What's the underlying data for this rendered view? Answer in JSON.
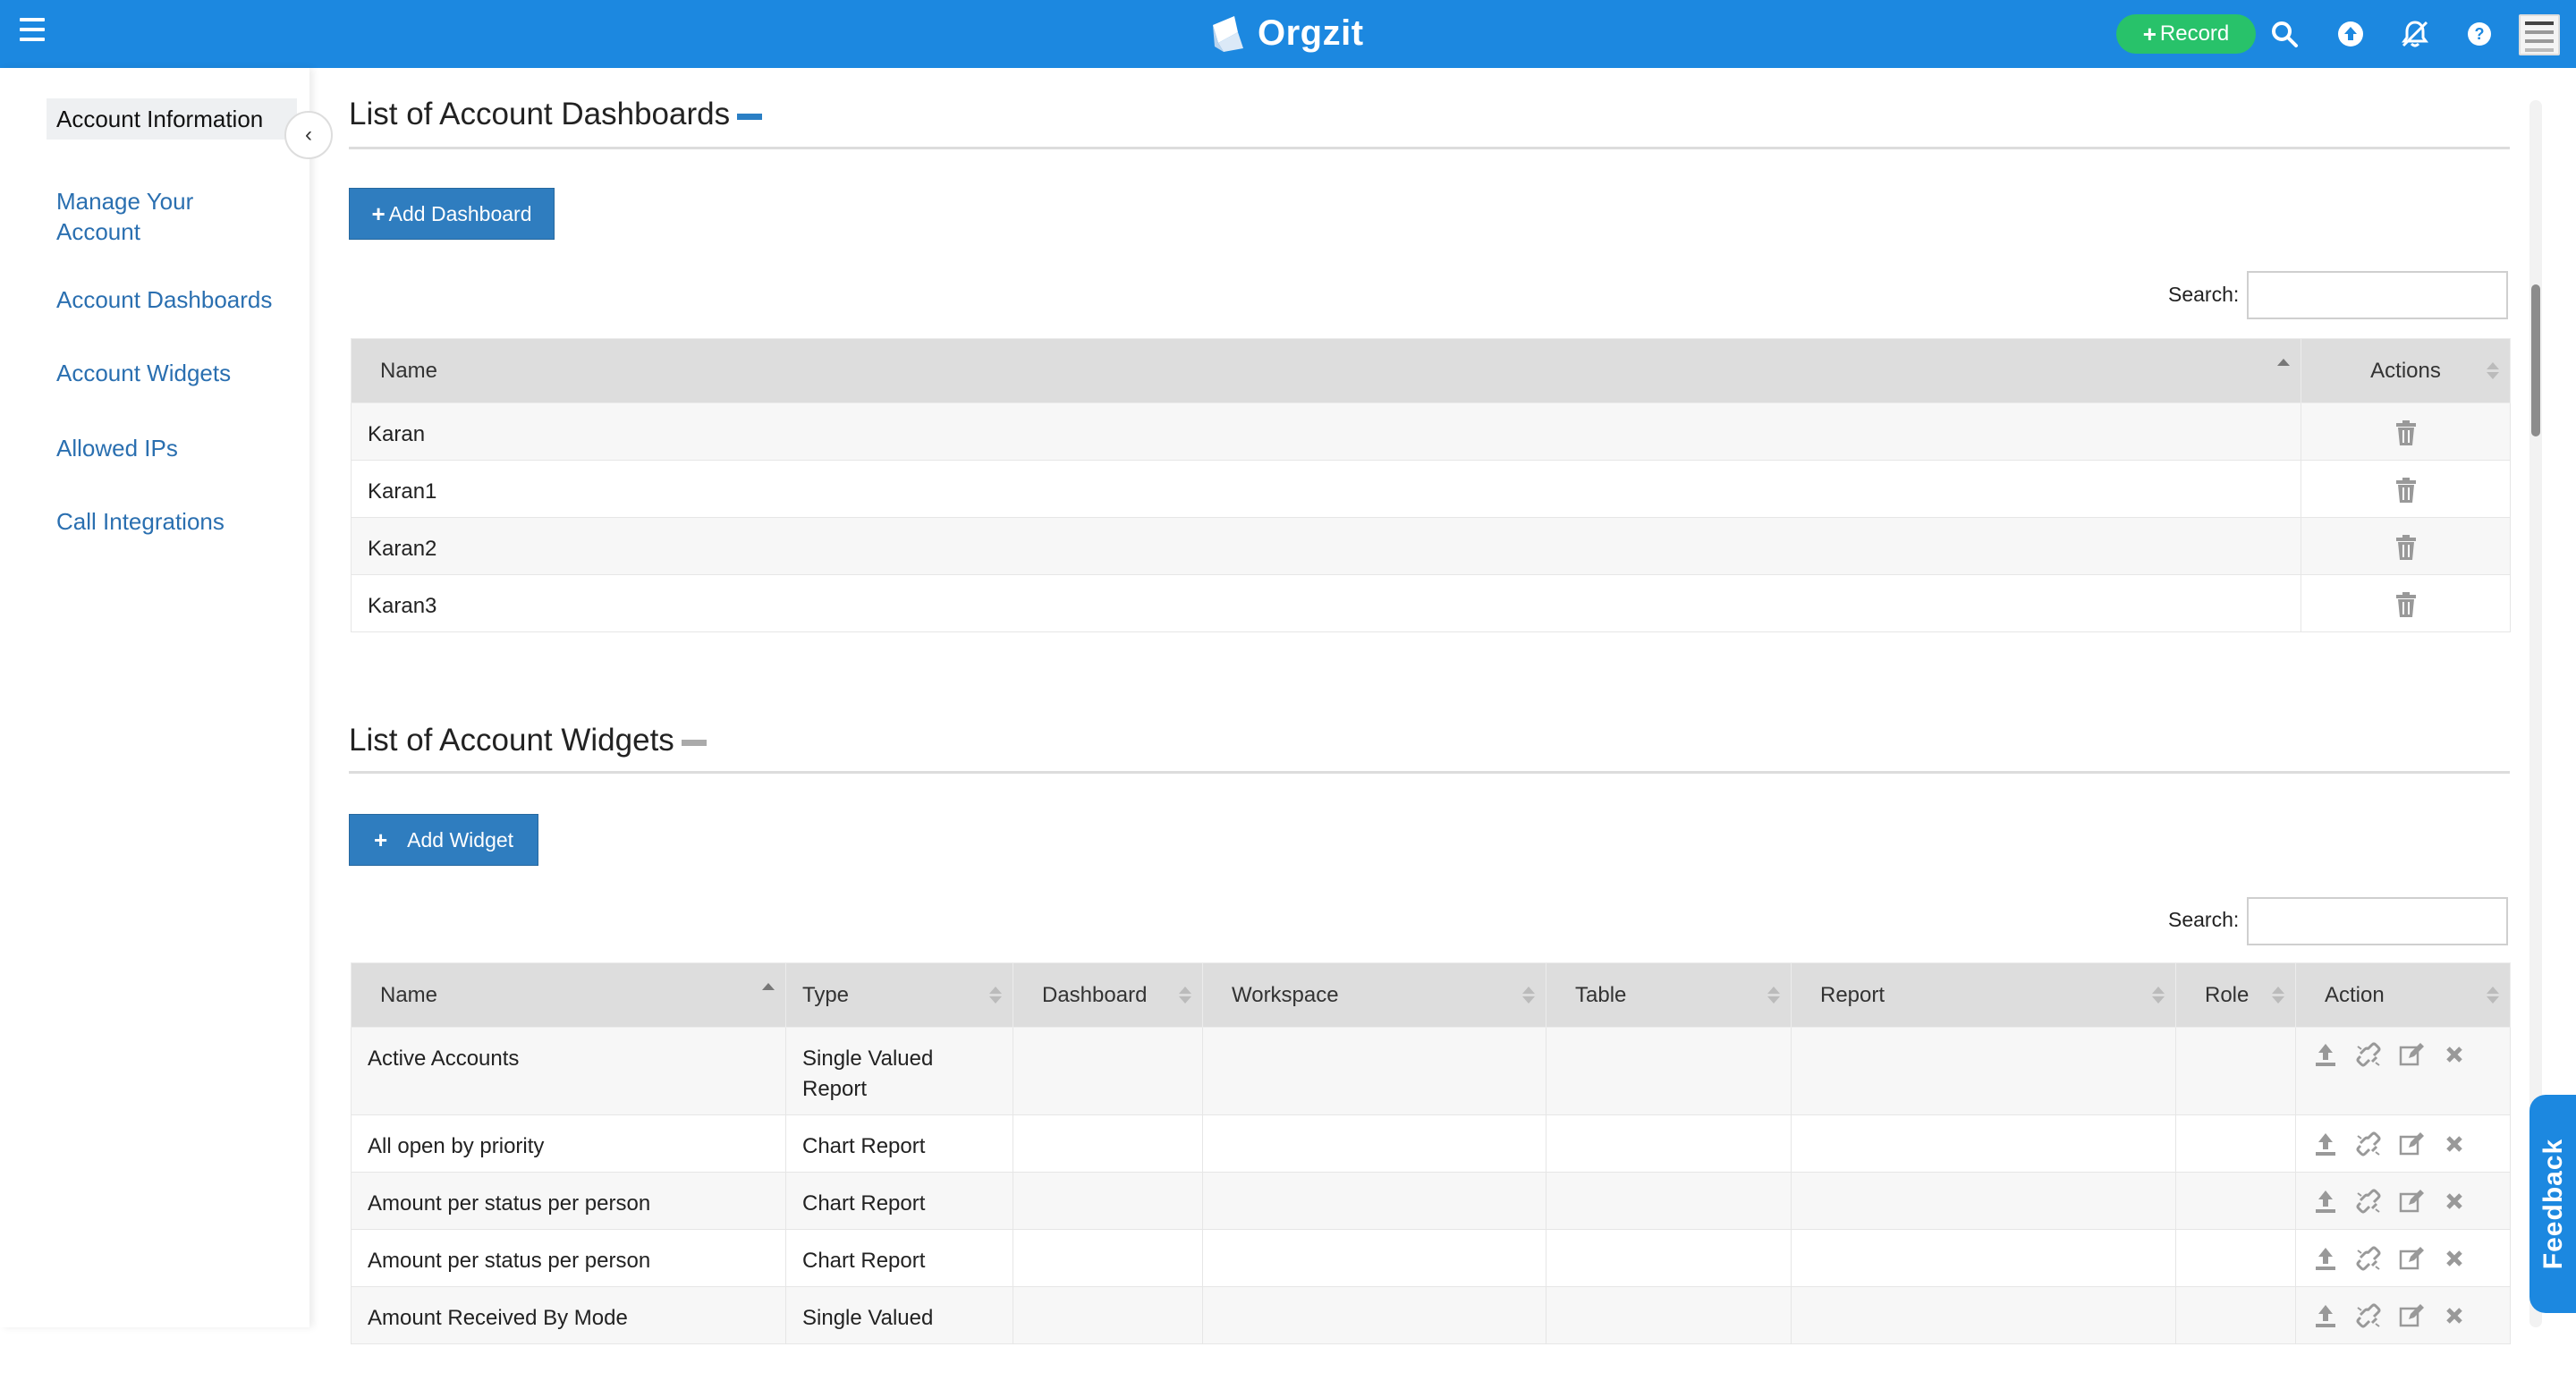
{
  "app": {
    "name": "Orgzit",
    "record_label": "Record",
    "brand_color": "#1c88e0",
    "record_color": "#28c26a"
  },
  "topbar_icons": [
    "menu-icon",
    "search-icon",
    "upload-icon",
    "notifications-off-icon",
    "help-icon",
    "avatar"
  ],
  "sidebar": {
    "items": [
      {
        "label": "Account Information",
        "active": true
      },
      {
        "label": "Manage Your Account"
      },
      {
        "label": "Account Dashboards"
      },
      {
        "label": "Account Widgets"
      },
      {
        "label": "Allowed IPs"
      },
      {
        "label": "Call Integrations"
      }
    ],
    "collapse_glyph": "‹"
  },
  "dashboards": {
    "title": "List of Account Dashboards",
    "add_label": "Add Dashboard",
    "search_label": "Search:",
    "columns": [
      "Name",
      "Actions"
    ],
    "rows": [
      "Karan",
      "Karan1",
      "Karan2",
      "Karan3"
    ]
  },
  "widgets": {
    "title": "List of Account Widgets",
    "add_label": "Add Widget",
    "search_label": "Search:",
    "columns": [
      "Name",
      "Type",
      "Dashboard",
      "Workspace",
      "Table",
      "Report",
      "Role",
      "Action"
    ],
    "rows": [
      {
        "name": "Active Accounts",
        "type_line1": "Single Valued",
        "type_line2": "Report"
      },
      {
        "name": "All open by priority",
        "type_line1": "Chart Report",
        "type_line2": ""
      },
      {
        "name": "Amount per status per person",
        "type_line1": "Chart Report",
        "type_line2": ""
      },
      {
        "name": "Amount per status per person",
        "type_line1": "Chart Report",
        "type_line2": ""
      },
      {
        "name": "Amount Received By Mode",
        "type_line1": "Single Valued",
        "type_line2": ""
      }
    ],
    "action_icons": [
      "upload-icon",
      "unlink-icon",
      "edit-icon",
      "delete-icon"
    ]
  },
  "feedback_label": "Feedback"
}
